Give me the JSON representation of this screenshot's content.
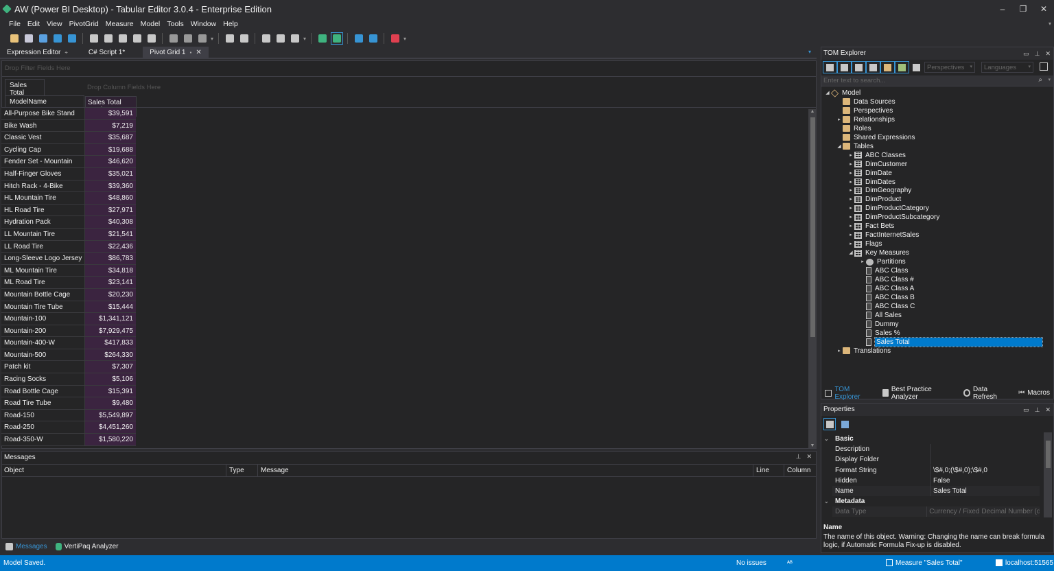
{
  "window": {
    "title": "AW (Power BI Desktop) - Tabular Editor 3.0.4 - Enterprise Edition",
    "minimize": "–",
    "restore": "❐",
    "close": "✕"
  },
  "menu": [
    "File",
    "Edit",
    "View",
    "PivotGrid",
    "Measure",
    "Model",
    "Tools",
    "Window",
    "Help"
  ],
  "toolbar_icons": [
    {
      "name": "open-from-db-icon",
      "color": "#e8c27a"
    },
    {
      "name": "deploy-icon",
      "color": "#c8c8d8"
    },
    {
      "name": "connect-icon",
      "color": "#5aa0e0"
    },
    {
      "name": "save-to-folder-icon",
      "color": "#3794d4"
    },
    {
      "name": "refresh-icon",
      "color": "#3794d4"
    },
    {
      "name": "new-doc-icon",
      "color": "#c8c8c8"
    },
    {
      "name": "new-pivot-icon",
      "color": "#c8c8c8"
    },
    {
      "name": "new-dax-query-icon",
      "color": "#c8c8c8"
    },
    {
      "name": "new-diagram-icon",
      "color": "#c8c8c8"
    },
    {
      "name": "new-script-icon",
      "color": "#c8c8c8"
    },
    {
      "name": "indent-icon",
      "color": "#999"
    },
    {
      "name": "outdent-icon",
      "color": "#999"
    },
    {
      "name": "format-icon",
      "color": "#999"
    },
    {
      "name": "align-icon",
      "color": "#c8c8c8"
    },
    {
      "name": "copy-format-icon",
      "color": "#c8c8c8"
    },
    {
      "name": "panel-icon",
      "color": "#c8c8c8"
    },
    {
      "name": "message-icon",
      "color": "#c8c8c8"
    },
    {
      "name": "layout-icon",
      "color": "#c8c8c8"
    },
    {
      "name": "auto-refresh-icon",
      "color": "#3fb37f"
    },
    {
      "name": "live-refresh-icon",
      "color": "#3fb37f"
    },
    {
      "name": "rows-icon",
      "color": "#3794d4"
    },
    {
      "name": "columns-icon",
      "color": "#3794d4"
    },
    {
      "name": "clear-filter-icon",
      "color": "#e04050"
    }
  ],
  "doc_tabs": [
    {
      "label": "Expression Editor",
      "pin": "⌖"
    },
    {
      "label": "C# Script 1*"
    },
    {
      "label": "Pivot Grid 1",
      "pin": "▪",
      "close": "✕"
    }
  ],
  "pivot": {
    "filter_placeholder": "Drop Filter Fields Here",
    "column_placeholder": "Drop Column Fields Here",
    "data_field": "Sales Total",
    "row_field": "ModelName",
    "value_header": "Sales Total Total",
    "rows": [
      {
        "name": "All-Purpose Bike Stand",
        "value": "$39,591"
      },
      {
        "name": "Bike Wash",
        "value": "$7,219"
      },
      {
        "name": "Classic Vest",
        "value": "$35,687"
      },
      {
        "name": "Cycling Cap",
        "value": "$19,688"
      },
      {
        "name": "Fender Set - Mountain",
        "value": "$46,620"
      },
      {
        "name": "Half-Finger Gloves",
        "value": "$35,021"
      },
      {
        "name": "Hitch Rack - 4-Bike",
        "value": "$39,360"
      },
      {
        "name": "HL Mountain Tire",
        "value": "$48,860"
      },
      {
        "name": "HL Road Tire",
        "value": "$27,971"
      },
      {
        "name": "Hydration Pack",
        "value": "$40,308"
      },
      {
        "name": "LL Mountain Tire",
        "value": "$21,541"
      },
      {
        "name": "LL Road Tire",
        "value": "$22,436"
      },
      {
        "name": "Long-Sleeve Logo Jersey",
        "value": "$86,783"
      },
      {
        "name": "ML Mountain Tire",
        "value": "$34,818"
      },
      {
        "name": "ML Road Tire",
        "value": "$23,141"
      },
      {
        "name": "Mountain Bottle Cage",
        "value": "$20,230"
      },
      {
        "name": "Mountain Tire Tube",
        "value": "$15,444"
      },
      {
        "name": "Mountain-100",
        "value": "$1,341,121"
      },
      {
        "name": "Mountain-200",
        "value": "$7,929,475"
      },
      {
        "name": "Mountain-400-W",
        "value": "$417,833"
      },
      {
        "name": "Mountain-500",
        "value": "$264,330"
      },
      {
        "name": "Patch kit",
        "value": "$7,307"
      },
      {
        "name": "Racing Socks",
        "value": "$5,106"
      },
      {
        "name": "Road Bottle Cage",
        "value": "$15,391"
      },
      {
        "name": "Road Tire Tube",
        "value": "$9,480"
      },
      {
        "name": "Road-150",
        "value": "$5,549,897"
      },
      {
        "name": "Road-250",
        "value": "$4,451,260"
      },
      {
        "name": "Road-350-W",
        "value": "$1,580,220"
      }
    ]
  },
  "messages": {
    "title": "Messages",
    "columns": [
      "Object",
      "Type",
      "Message",
      "Line",
      "Column"
    ],
    "tabs": [
      "Messages",
      "VertiPaq Analyzer"
    ]
  },
  "tom": {
    "title": "TOM Explorer",
    "perspectives": "Perspectives",
    "languages": "Languages",
    "search_placeholder": "Enter text to search...",
    "tree": [
      {
        "label": "Model",
        "icon": "model",
        "level": 0,
        "arrow": "◢"
      },
      {
        "label": "Data Sources",
        "icon": "folder",
        "level": 1,
        "arrow": ""
      },
      {
        "label": "Perspectives",
        "icon": "folder",
        "level": 1,
        "arrow": ""
      },
      {
        "label": "Relationships",
        "icon": "folder",
        "level": 1,
        "arrow": "▸"
      },
      {
        "label": "Roles",
        "icon": "folder",
        "level": 1,
        "arrow": ""
      },
      {
        "label": "Shared Expressions",
        "icon": "folder",
        "level": 1,
        "arrow": ""
      },
      {
        "label": "Tables",
        "icon": "folder",
        "level": 1,
        "arrow": "◢"
      },
      {
        "label": "ABC Classes",
        "icon": "table",
        "level": 2,
        "arrow": "▸"
      },
      {
        "label": "DimCustomer",
        "icon": "table",
        "level": 2,
        "arrow": "▸"
      },
      {
        "label": "DimDate",
        "icon": "table",
        "level": 2,
        "arrow": "▸"
      },
      {
        "label": "DimDates",
        "icon": "table",
        "level": 2,
        "arrow": "▸"
      },
      {
        "label": "DimGeography",
        "icon": "table",
        "level": 2,
        "arrow": "▸"
      },
      {
        "label": "DimProduct",
        "icon": "table",
        "level": 2,
        "arrow": "▸"
      },
      {
        "label": "DimProductCategory",
        "icon": "table",
        "level": 2,
        "arrow": "▸"
      },
      {
        "label": "DimProductSubcategory",
        "icon": "table",
        "level": 2,
        "arrow": "▸"
      },
      {
        "label": "Fact Bets",
        "icon": "table",
        "level": 2,
        "arrow": "▸"
      },
      {
        "label": "FactInternetSales",
        "icon": "table",
        "level": 2,
        "arrow": "▸"
      },
      {
        "label": "Flags",
        "icon": "table",
        "level": 2,
        "arrow": "▸"
      },
      {
        "label": "Key Measures",
        "icon": "table",
        "level": 2,
        "arrow": "◢"
      },
      {
        "label": "Partitions",
        "icon": "partition",
        "level": 3,
        "arrow": "▸"
      },
      {
        "label": "ABC Class",
        "icon": "measure",
        "level": 3,
        "arrow": ""
      },
      {
        "label": "ABC Class #",
        "icon": "measure",
        "level": 3,
        "arrow": ""
      },
      {
        "label": "ABC Class A",
        "icon": "measure",
        "level": 3,
        "arrow": ""
      },
      {
        "label": "ABC Class B",
        "icon": "measure",
        "level": 3,
        "arrow": ""
      },
      {
        "label": "ABC Class C",
        "icon": "measure",
        "level": 3,
        "arrow": ""
      },
      {
        "label": "All Sales",
        "icon": "measure",
        "level": 3,
        "arrow": ""
      },
      {
        "label": "Dummy",
        "icon": "measure",
        "level": 3,
        "arrow": ""
      },
      {
        "label": "Sales %",
        "icon": "measure",
        "level": 3,
        "arrow": ""
      },
      {
        "label": "Sales Total",
        "icon": "measure",
        "level": 3,
        "arrow": "",
        "selected": true
      },
      {
        "label": "Translations",
        "icon": "folder",
        "level": 1,
        "arrow": "▸"
      }
    ],
    "bottom_tabs": [
      "TOM Explorer",
      "Best Practice Analyzer",
      "Data Refresh",
      "Macros"
    ]
  },
  "properties": {
    "title": "Properties",
    "categories": [
      {
        "label": "Basic",
        "rows": [
          {
            "name": "Description",
            "value": ""
          },
          {
            "name": "Display Folder",
            "value": ""
          },
          {
            "name": "Format String",
            "value": "\\$#,0;(\\$#,0);\\$#,0"
          },
          {
            "name": "Hidden",
            "value": "False"
          },
          {
            "name": "Name",
            "value": "Sales Total"
          }
        ]
      },
      {
        "label": "Metadata",
        "rows": [
          {
            "name": "Data Type",
            "value": "Currency / Fixed Decimal Number (de",
            "disabled": true
          }
        ]
      }
    ],
    "help_title": "Name",
    "help_text": "The name of this object. Warning: Changing the name can break formula logic, if Automatic Formula Fix-up is disabled."
  },
  "status": {
    "left": "Model Saved.",
    "issues": "No issues",
    "selection": "Measure \"Sales Total\"",
    "server": "localhost:51565"
  },
  "colors": {
    "accent": "#007acc",
    "pivot_value_bg": "#3b2440",
    "background": "#2d2d30",
    "panel": "#252526"
  }
}
